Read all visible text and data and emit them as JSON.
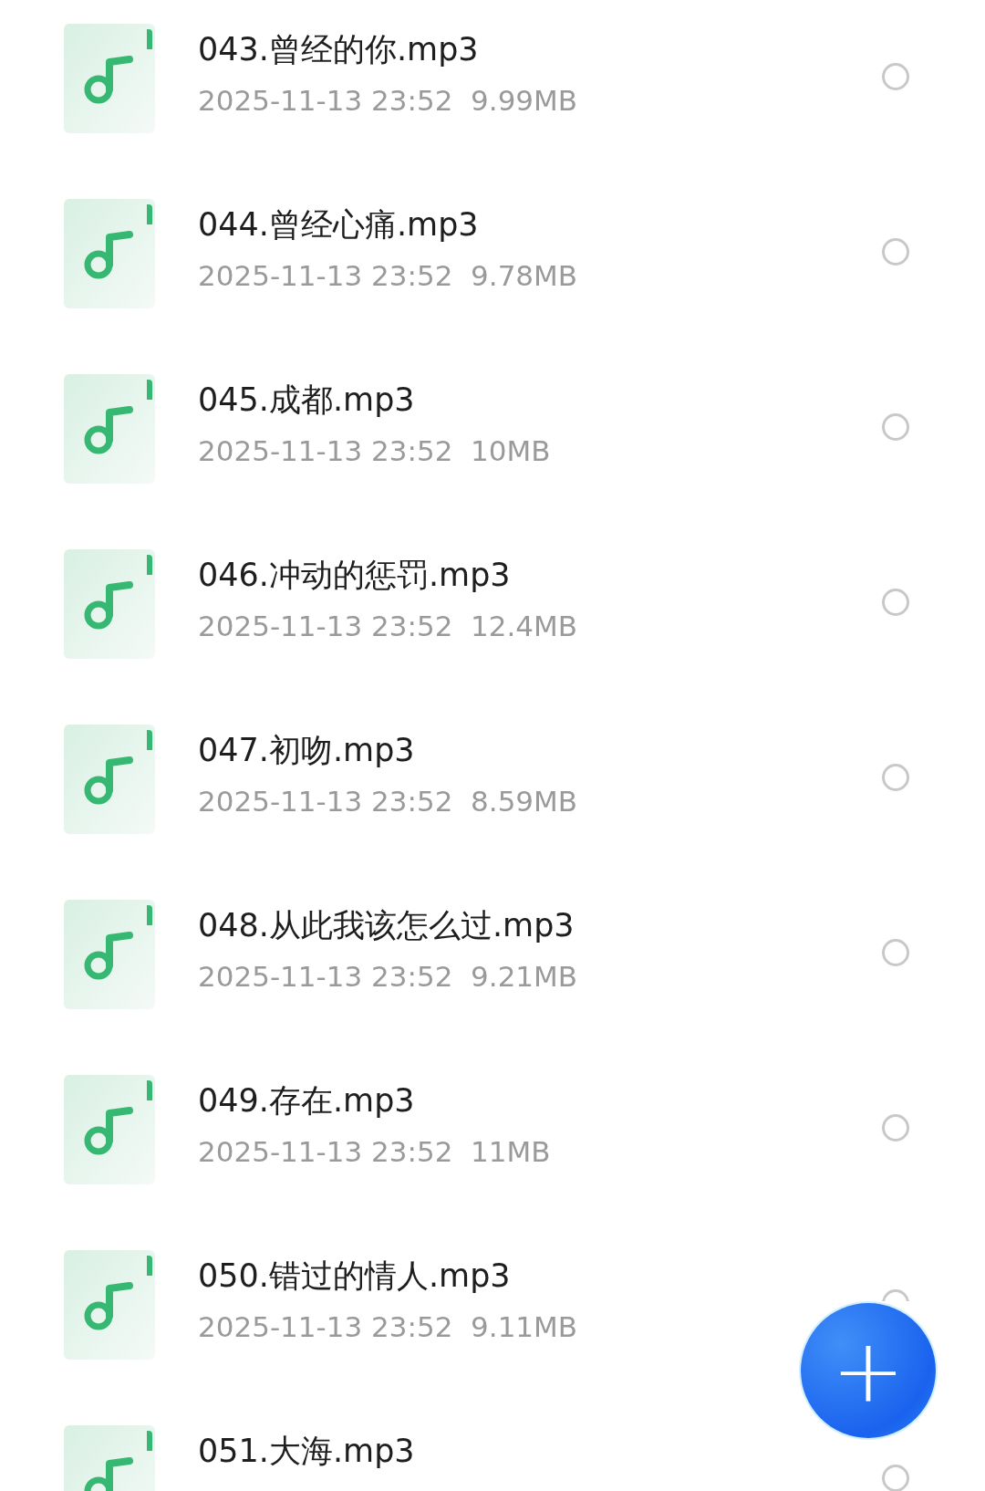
{
  "files": [
    {
      "name": "043.曾经的你.mp3",
      "meta": "2025-11-13 23:52  9.99MB",
      "selected": false
    },
    {
      "name": "044.曾经心痛.mp3",
      "meta": "2025-11-13 23:52  9.78MB",
      "selected": false
    },
    {
      "name": "045.成都.mp3",
      "meta": "2025-11-13 23:52  10MB",
      "selected": false
    },
    {
      "name": "046.冲动的惩罚.mp3",
      "meta": "2025-11-13 23:52  12.4MB",
      "selected": false
    },
    {
      "name": "047.初吻.mp3",
      "meta": "2025-11-13 23:52  8.59MB",
      "selected": false
    },
    {
      "name": "048.从此我该怎么过.mp3",
      "meta": "2025-11-13 23:52  9.21MB",
      "selected": false
    },
    {
      "name": "049.存在.mp3",
      "meta": "2025-11-13 23:52  11MB",
      "selected": false
    },
    {
      "name": "050.错过的情人.mp3",
      "meta": "2025-11-13 23:52  9.11MB",
      "selected": false
    },
    {
      "name": "051.大海.mp3",
      "selected": false
    }
  ],
  "fab": {
    "label": "+"
  }
}
